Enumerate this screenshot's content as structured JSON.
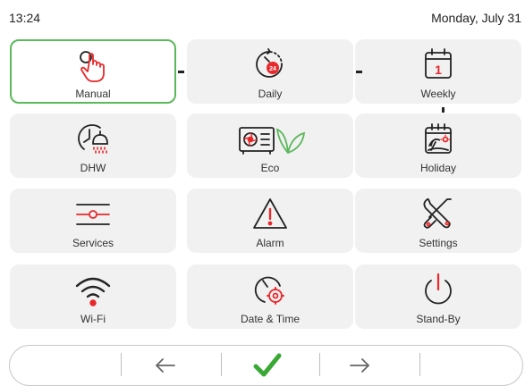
{
  "status": {
    "time": "13:24",
    "date": "Monday, July 31"
  },
  "tiles": [
    {
      "label": "Manual",
      "icon": "hand-pointer-icon",
      "selected": true
    },
    {
      "label": "Daily",
      "icon": "clock-24-icon"
    },
    {
      "label": "Weekly",
      "icon": "calendar-1-icon"
    },
    {
      "label": "DHW",
      "icon": "hot-water-shower-icon"
    },
    {
      "label": "Eco",
      "icon": "heat-pump-leaf-icon"
    },
    {
      "label": "Holiday",
      "icon": "calendar-beach-icon"
    },
    {
      "label": "Services",
      "icon": "sliders-icon"
    },
    {
      "label": "Alarm",
      "icon": "warning-triangle-icon"
    },
    {
      "label": "Settings",
      "icon": "wrench-screwdriver-icon"
    },
    {
      "label": "Wi-Fi",
      "icon": "wifi-icon"
    },
    {
      "label": "Date & Time",
      "icon": "clock-gear-icon"
    },
    {
      "label": "Stand-By",
      "icon": "power-icon"
    }
  ],
  "bottom_bar": {
    "buttons": [
      "back-arrow-icon",
      "confirm-check-icon",
      "forward-arrow-icon"
    ]
  },
  "colors": {
    "accent_red": "#e8282b",
    "selected_border": "#5cb85c",
    "check_green": "#3aa835",
    "tile_bg": "#f1f1f1"
  }
}
